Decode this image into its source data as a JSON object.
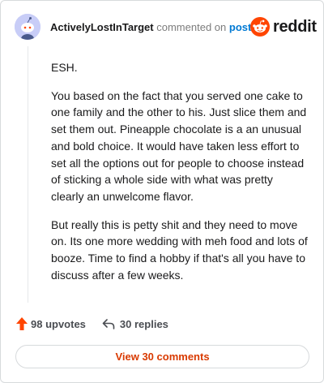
{
  "comment": {
    "username": "ActivelyLostInTarget",
    "commented_text": "commented on",
    "post_link": "post",
    "paragraphs": [
      "ESH.",
      "You based on the fact that you served one cake to one family and the other to his. Just slice them and set them out. Pineapple chocolate is a an unusual and bold choice. It would have taken less effort to set all the options out for people to choose instead of sticking a whole side with what was pretty clearly an unwelcome flavor.",
      "But really this is petty shit and they need to move on. Its one more wedding with meh food and lots of booze. Time to find a hobby if that's all you have to discuss after a few weeks."
    ]
  },
  "logo": {
    "text": "reddit",
    "icon": "reddit-snoo-icon",
    "color": "#ff4500"
  },
  "actions": {
    "upvotes_label": "98 upvotes",
    "upvote_icon": "upvote-arrow-icon",
    "upvote_color": "#ff4500",
    "replies_label": "30 replies",
    "reply_icon": "reply-arrow-icon"
  },
  "view_comments_label": "View 30 comments",
  "avatar_icon": "snoo-avatar-icon"
}
